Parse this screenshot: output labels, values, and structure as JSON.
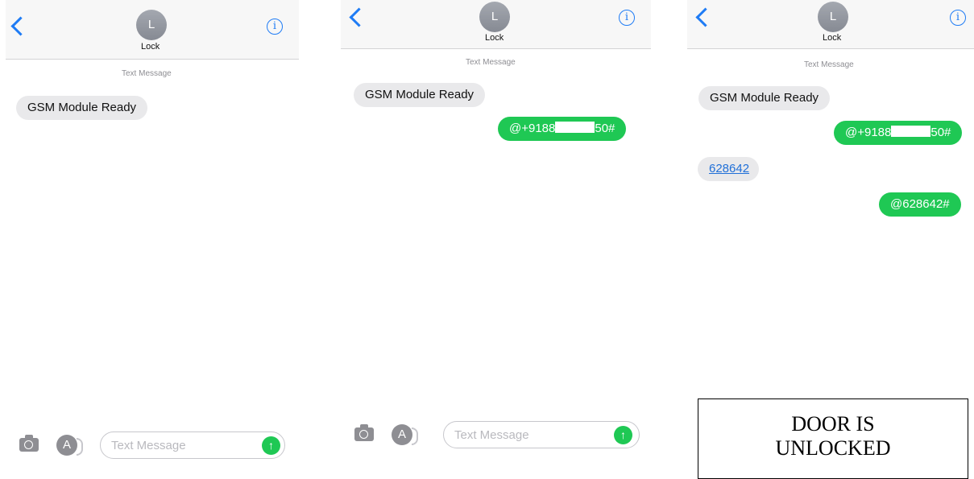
{
  "contact": {
    "initial": "L",
    "name": "Lock"
  },
  "timestamp_label": "Text Message",
  "composer": {
    "placeholder": "Text Message",
    "send_icon": "↑",
    "appstore_icon": "A"
  },
  "messages": {
    "ready": "GSM Module Ready",
    "phone_prefix": "@+9188",
    "phone_suffix": "50#",
    "code": "628642",
    "code_reply": "@628642#"
  },
  "door_status": {
    "line1": "DOOR IS",
    "line2": "UNLOCKED"
  },
  "colors": {
    "accent": "#1f7cf5",
    "outgoing": "#1fc854",
    "incoming": "#e9e9eb"
  }
}
